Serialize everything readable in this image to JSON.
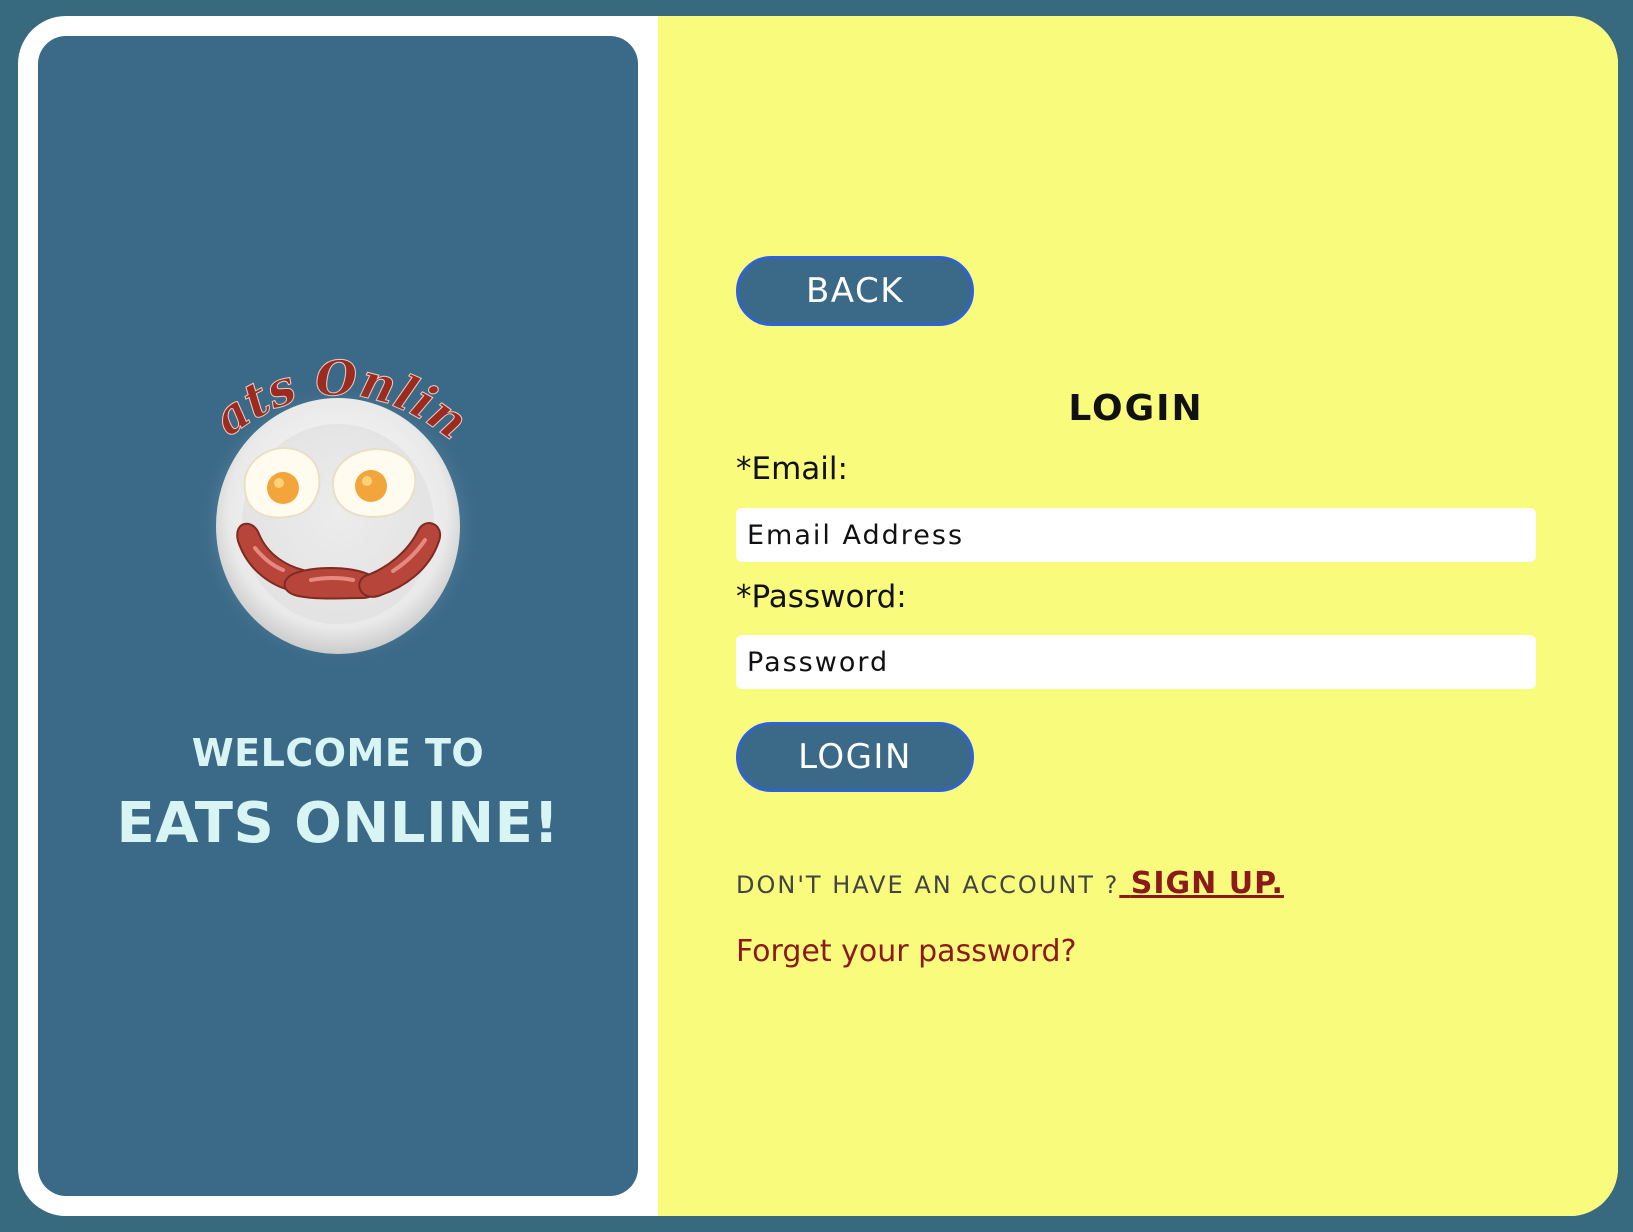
{
  "brand": {
    "logo_text": "Eats Online",
    "logo_icon": "breakfast-plate-smiley"
  },
  "welcome": {
    "line1": "WELCOME TO",
    "line2": "EATS ONLINE!"
  },
  "buttons": {
    "back": "BACK",
    "login": "LOGIN"
  },
  "form": {
    "title": "LOGIN",
    "email_label": "*Email:",
    "email_placeholder": "Email Address",
    "email_value": "",
    "password_label": "*Password:",
    "password_placeholder": "Password",
    "password_value": ""
  },
  "links": {
    "no_account_text": "DON'T HAVE AN ACCOUNT ?",
    "signup": "SIGN UP.",
    "forgot_password": "Forget your password?"
  },
  "colors": {
    "page_background": "#386a7f",
    "left_panel": "#3b6a88",
    "right_panel": "#f9fb7d",
    "button_border": "#2f62d6",
    "link": "#8b1a1a",
    "welcome_text": "#d8f5f3"
  }
}
